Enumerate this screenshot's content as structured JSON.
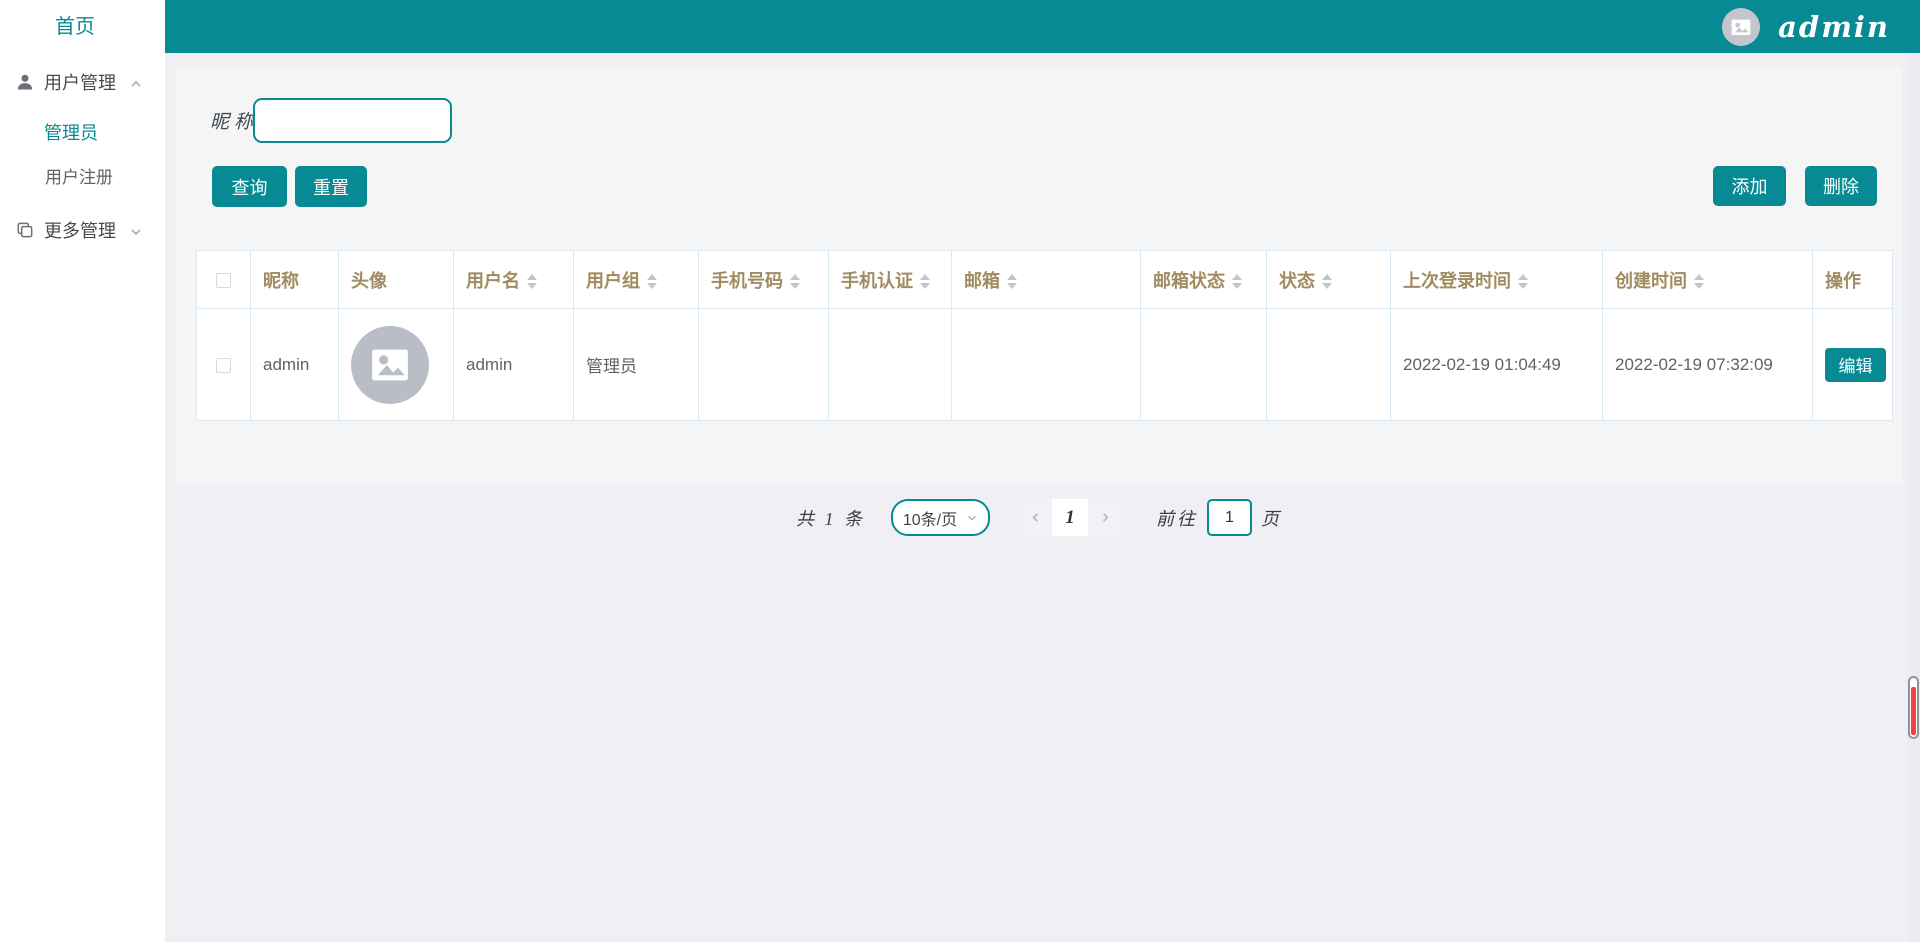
{
  "sidebar": {
    "home_label": "首页",
    "user_mgmt_label": "用户管理",
    "admin_item_label": "管理员",
    "register_item_label": "用户注册",
    "more_mgmt_label": "更多管理"
  },
  "header": {
    "username": "admin"
  },
  "search": {
    "nickname_label": "昵称",
    "nickname_value": "",
    "query_label": "查询",
    "reset_label": "重置"
  },
  "toolbar": {
    "add_label": "添加",
    "delete_label": "删除"
  },
  "table": {
    "columns": [
      {
        "label": "昵称",
        "sortable": false
      },
      {
        "label": "头像",
        "sortable": false
      },
      {
        "label": "用户名",
        "sortable": true
      },
      {
        "label": "用户组",
        "sortable": true
      },
      {
        "label": "手机号码",
        "sortable": true
      },
      {
        "label": "手机认证",
        "sortable": true
      },
      {
        "label": "邮箱",
        "sortable": true
      },
      {
        "label": "邮箱状态",
        "sortable": true
      },
      {
        "label": "状态",
        "sortable": true
      },
      {
        "label": "上次登录时间",
        "sortable": true
      },
      {
        "label": "创建时间",
        "sortable": true
      },
      {
        "label": "操作",
        "sortable": false
      }
    ],
    "row": {
      "nickname": "admin",
      "avatar": "image-placeholder-icon",
      "username": "admin",
      "user_group": "管理员",
      "phone": "",
      "phone_auth": "",
      "email": "",
      "email_status": "",
      "status": "",
      "last_login_time": "2022-02-19 01:04:49",
      "create_time": "2022-02-19 07:32:09",
      "edit_label": "编辑"
    }
  },
  "pagination": {
    "total_text": "共 1 条",
    "page_size_text": "10条/页",
    "current_page": "1",
    "goto_label": "前往",
    "goto_value": "1",
    "page_unit": "页"
  },
  "colors": {
    "teal": "#078a93",
    "table_header_text": "#a18b60",
    "table_border": "#d9eaf7",
    "scrollbar_red": "#f5413d",
    "avatar_gray": "#b9bdc5"
  }
}
